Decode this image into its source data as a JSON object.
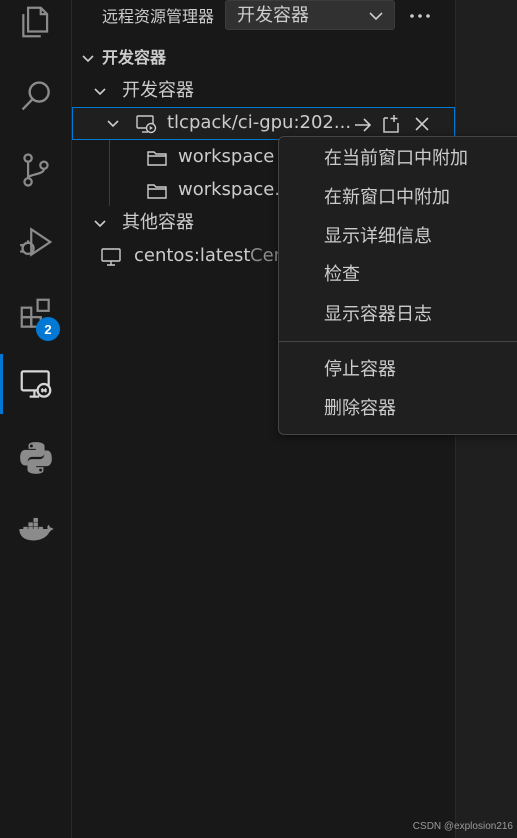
{
  "activity_bar": {
    "items": [
      {
        "icon": "files-icon"
      },
      {
        "icon": "search-icon"
      },
      {
        "icon": "source-control-icon"
      },
      {
        "icon": "run-debug-icon"
      },
      {
        "icon": "extensions-icon",
        "badge": "2"
      },
      {
        "icon": "remote-explorer-icon",
        "active": true
      },
      {
        "icon": "python-icon"
      },
      {
        "icon": "docker-icon"
      }
    ]
  },
  "sidebar": {
    "title": "远程资源管理器",
    "selector_value": "开发容器",
    "more_label": "···",
    "section_title": "开发容器",
    "tree": {
      "dev_group": "开发容器",
      "container": "tlcpack/ci-gpu:202...",
      "folder1": "workspace",
      "folder2": "workspace.c",
      "other_group": "其他容器",
      "other_item": "centos:latest",
      "other_item_desc": "Cen"
    }
  },
  "context_menu": {
    "items": [
      "在当前窗口中附加",
      "在新窗口中附加",
      "显示详细信息",
      "检查",
      "显示容器日志"
    ],
    "items2": [
      "停止容器",
      "删除容器"
    ]
  },
  "watermark": "CSDN @explosion216",
  "colors": {
    "background": "#181818",
    "accent": "#0078d4",
    "text": "#cccccc",
    "menu_bg": "#1f1f1f"
  }
}
